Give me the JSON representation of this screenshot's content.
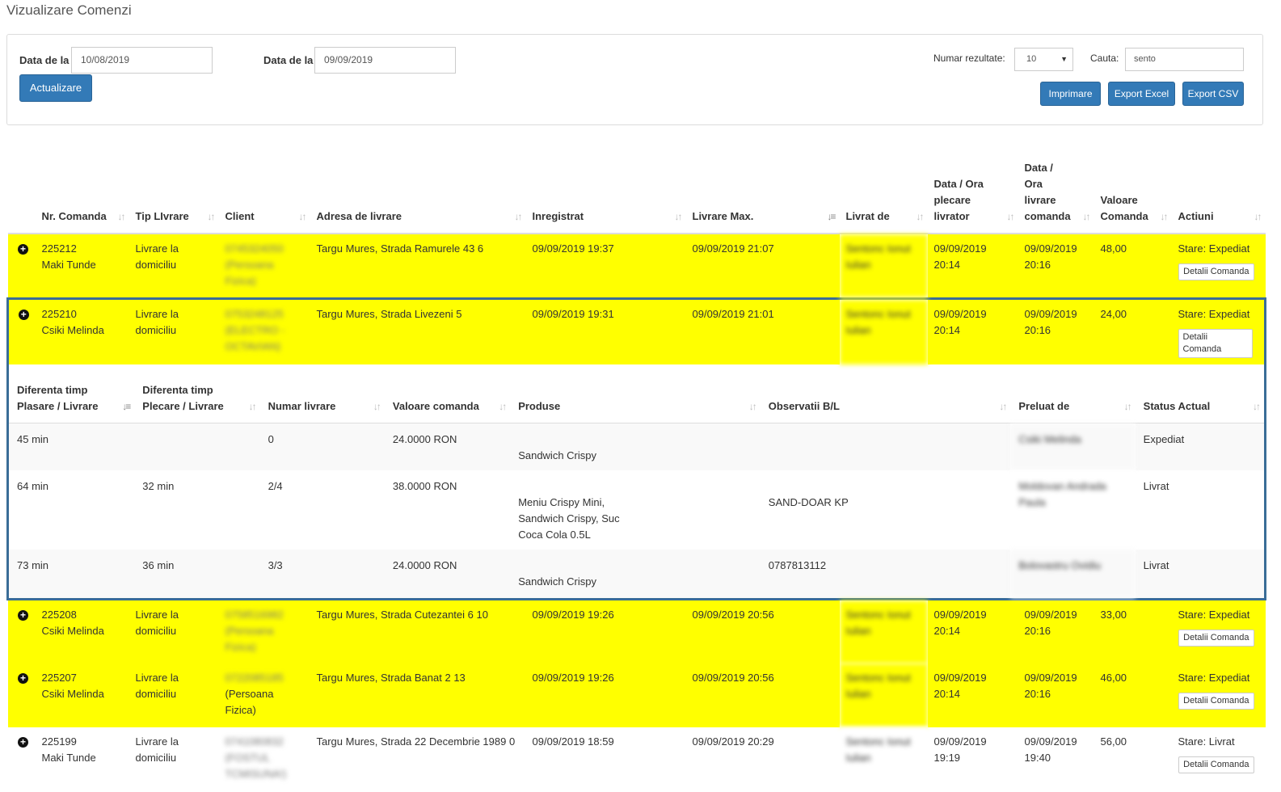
{
  "page": {
    "title": "Vizualizare Comenzi"
  },
  "filters": {
    "date_from_label": "Data de la",
    "date_from_value": "10/08/2019",
    "date_to_label": "Data de la",
    "date_to_value": "09/09/2019",
    "update_label": "Actualizare",
    "results_label": "Numar rezultate:",
    "results_value": "10",
    "search_label": "Cauta:",
    "search_value": "sento",
    "print_label": "Imprimare",
    "export_excel_label": "Export Excel",
    "export_csv_label": "Export CSV"
  },
  "table": {
    "headers": {
      "nr_comanda": "Nr. Comanda",
      "tip_livrare": "Tip LIvrare",
      "client": "Client",
      "adresa": "Adresa de livrare",
      "inregistrat": "Inregistrat",
      "livrare_max": "Livrare Max.",
      "livrat_de": "Livrat de",
      "plecare": "Data / Ora plecare livrator",
      "livrare_comanda": "Data / Ora livrare comanda",
      "valoare": "Valoare Comanda",
      "actiuni": "Actiuni"
    },
    "details_button": "Detalii Comanda",
    "rows": [
      {
        "nr": "225212",
        "name": "Maki Tunde",
        "tip": "Livrare la domiciliu",
        "client_phone": "0745324050",
        "client_type": "(Persoana Fizica)",
        "address": "Targu Mures, Strada Ramurele 43 6",
        "registered": "09/09/2019 19:37",
        "max_delivery": "09/09/2019 21:07",
        "courier": "Sentonc Ionut Iulian",
        "departure": "09/09/2019 20:14",
        "delivered": "09/09/2019 20:16",
        "value": "48,00",
        "status": "Stare: Expediat"
      },
      {
        "nr": "225210",
        "name": "Csiki Melinda",
        "tip": "Livrare la domiciliu",
        "client_phone": "0753248125",
        "client_type": "(ELECTRO - OCTAVIAN)",
        "address": "Targu Mures, Strada Livezeni 5",
        "registered": "09/09/2019 19:31",
        "max_delivery": "09/09/2019 21:01",
        "courier": "Sentonc Ionut Iulian",
        "departure": "09/09/2019 20:14",
        "delivered": "09/09/2019 20:16",
        "value": "24,00",
        "status": "Stare: Expediat"
      },
      {
        "nr": "225208",
        "name": "Csiki Melinda",
        "tip": "Livrare la domiciliu",
        "client_phone": "0758516982",
        "client_type": "(Persoana Fizica)",
        "address": "Targu Mures, Strada Cutezantei 6 10",
        "registered": "09/09/2019 19:26",
        "max_delivery": "09/09/2019 20:56",
        "courier": "Sentonc Ionut Iulian",
        "departure": "09/09/2019 20:14",
        "delivered": "09/09/2019 20:16",
        "value": "33,00",
        "status": "Stare: Expediat"
      },
      {
        "nr": "225207",
        "name": "Csiki Melinda",
        "tip": "Livrare la domiciliu",
        "client_phone": "0722085185",
        "client_type": "(Persoana Fizica)",
        "address": "Targu Mures, Strada Banat 2 13",
        "registered": "09/09/2019 19:26",
        "max_delivery": "09/09/2019 20:56",
        "courier": "Sentonc Ionut Iulian",
        "departure": "09/09/2019 20:14",
        "delivered": "09/09/2019 20:16",
        "value": "46,00",
        "status": "Stare: Expediat"
      },
      {
        "nr": "225199",
        "name": "Maki Tunde",
        "tip": "Livrare la domiciliu",
        "client_phone": "0741080832",
        "client_type": "(FOSTUL TCMISUNA!)",
        "address": "Targu Mures, Strada 22 Decembrie 1989 0",
        "registered": "09/09/2019 18:59",
        "max_delivery": "09/09/2019 20:29",
        "courier": "Sentonc Ionut Iulian",
        "departure": "09/09/2019 19:19",
        "delivered": "09/09/2019 19:40",
        "value": "56,00",
        "status": "Stare: Livrat"
      }
    ]
  },
  "details": {
    "headers": {
      "dif_plasare": "Diferenta timp Plasare / Livrare",
      "dif_plecare": "Diferenta timp Plecare / Livrare",
      "numar": "Numar livrare",
      "valoare": "Valoare comanda",
      "produse": "Produse",
      "observatii": "Observatii B/L",
      "preluat": "Preluat de",
      "status": "Status Actual"
    },
    "rows": [
      {
        "dif_plasare": "45 min",
        "dif_plecare": "",
        "numar": "0",
        "valoare": "24.0000 RON",
        "produse": "Sandwich Crispy",
        "observatii": "",
        "preluat": "Csiki Melinda",
        "status": "Expediat"
      },
      {
        "dif_plasare": "64 min",
        "dif_plecare": "32 min",
        "numar": "2/4",
        "valoare": "38.0000 RON",
        "produse": "Meniu Crispy Mini, Sandwich Crispy, Suc Coca Cola 0.5L",
        "observatii": "SAND-DOAR KP",
        "preluat": "Moldovan Andrada Paula",
        "status": "Livrat"
      },
      {
        "dif_plasare": "73 min",
        "dif_plecare": "36 min",
        "numar": "3/3",
        "valoare": "24.0000 RON",
        "produse": "Sandwich Crispy",
        "observatii": "0787813112",
        "preluat": "Bolovastru Ovidiu",
        "status": "Livrat"
      }
    ]
  }
}
